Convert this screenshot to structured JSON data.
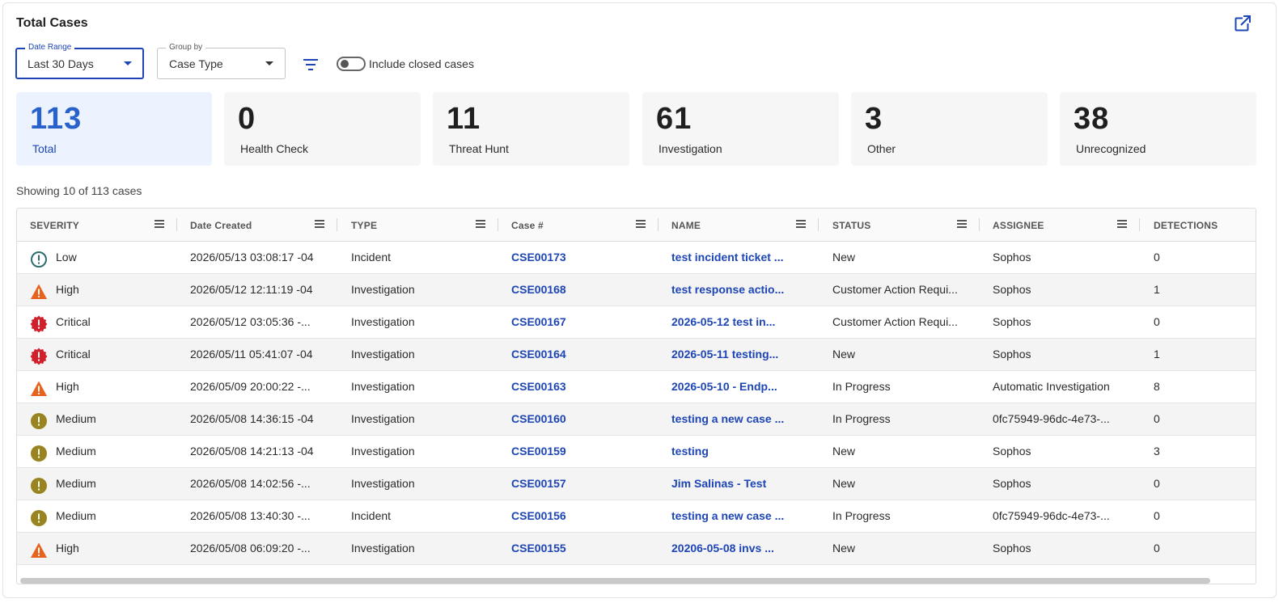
{
  "title": "Total Cases",
  "filters": {
    "date_range": {
      "label": "Date Range",
      "value": "Last 30 Days"
    },
    "group_by": {
      "label": "Group by",
      "value": "Case Type"
    },
    "include_closed_label": "Include closed cases",
    "include_closed_enabled": false
  },
  "stats": [
    {
      "count": "113",
      "label": "Total"
    },
    {
      "count": "0",
      "label": "Health Check"
    },
    {
      "count": "11",
      "label": "Threat Hunt"
    },
    {
      "count": "61",
      "label": "Investigation"
    },
    {
      "count": "3",
      "label": "Other"
    },
    {
      "count": "38",
      "label": "Unrecognized"
    }
  ],
  "showing_text": "Showing 10 of 113 cases",
  "columns": [
    "SEVERITY",
    "Date Created",
    "TYPE",
    "Case #",
    "NAME",
    "STATUS",
    "ASSIGNEE",
    "DETECTIONS"
  ],
  "rows": [
    {
      "severity": "Low",
      "icon": "info-circle-icon",
      "date": "2026/05/13 03:08:17 -04",
      "type": "Incident",
      "case": "CSE00173",
      "name": "test incident ticket ...",
      "status": "New",
      "assignee": "Sophos",
      "detections": "0"
    },
    {
      "severity": "High",
      "icon": "warning-triangle-icon",
      "date": "2026/05/12 12:11:19 -04",
      "type": "Investigation",
      "case": "CSE00168",
      "name": "test response actio...",
      "status": "Customer Action Requi...",
      "assignee": "Sophos",
      "detections": "1"
    },
    {
      "severity": "Critical",
      "icon": "critical-badge-icon",
      "date": "2026/05/12 03:05:36 -...",
      "type": "Investigation",
      "case": "CSE00167",
      "name": "2026-05-12 test in...",
      "status": "Customer Action Requi...",
      "assignee": "Sophos",
      "detections": "0"
    },
    {
      "severity": "Critical",
      "icon": "critical-badge-icon",
      "date": "2026/05/11 05:41:07 -04",
      "type": "Investigation",
      "case": "CSE00164",
      "name": "2026-05-11 testing...",
      "status": "New",
      "assignee": "Sophos",
      "detections": "1"
    },
    {
      "severity": "High",
      "icon": "warning-triangle-icon",
      "date": "2026/05/09 20:00:22 -...",
      "type": "Investigation",
      "case": "CSE00163",
      "name": "2026-05-10 - Endp...",
      "status": "In Progress",
      "assignee": "Automatic Investigation",
      "detections": "8"
    },
    {
      "severity": "Medium",
      "icon": "exclamation-circle-icon",
      "date": "2026/05/08 14:36:15 -04",
      "type": "Investigation",
      "case": "CSE00160",
      "name": "testing a new case ...",
      "status": "In Progress",
      "assignee": "0fc75949-96dc-4e73-...",
      "detections": "0"
    },
    {
      "severity": "Medium",
      "icon": "exclamation-circle-icon",
      "date": "2026/05/08 14:21:13 -04",
      "type": "Investigation",
      "case": "CSE00159",
      "name": "testing",
      "status": "New",
      "assignee": "Sophos",
      "detections": "3"
    },
    {
      "severity": "Medium",
      "icon": "exclamation-circle-icon",
      "date": "2026/05/08 14:02:56 -...",
      "type": "Investigation",
      "case": "CSE00157",
      "name": "Jim Salinas - Test",
      "status": "New",
      "assignee": "Sophos",
      "detections": "0"
    },
    {
      "severity": "Medium",
      "icon": "exclamation-circle-icon",
      "date": "2026/05/08 13:40:30 -...",
      "type": "Incident",
      "case": "CSE00156",
      "name": "testing a new case ...",
      "status": "In Progress",
      "assignee": "0fc75949-96dc-4e73-...",
      "detections": "0"
    },
    {
      "severity": "High",
      "icon": "warning-triangle-icon",
      "date": "2026/05/08 06:09:20 -...",
      "type": "Investigation",
      "case": "CSE00155",
      "name": "20206-05-08 invs ...",
      "status": "New",
      "assignee": "Sophos",
      "detections": "0"
    }
  ],
  "colors": {
    "accent": "#1d45b5",
    "active_count": "#2762cc",
    "active_card_bg": "#ecf3fe",
    "low": "#2f6b73",
    "high": "#e8621d",
    "critical": "#d0202a",
    "medium": "#9a8420"
  }
}
